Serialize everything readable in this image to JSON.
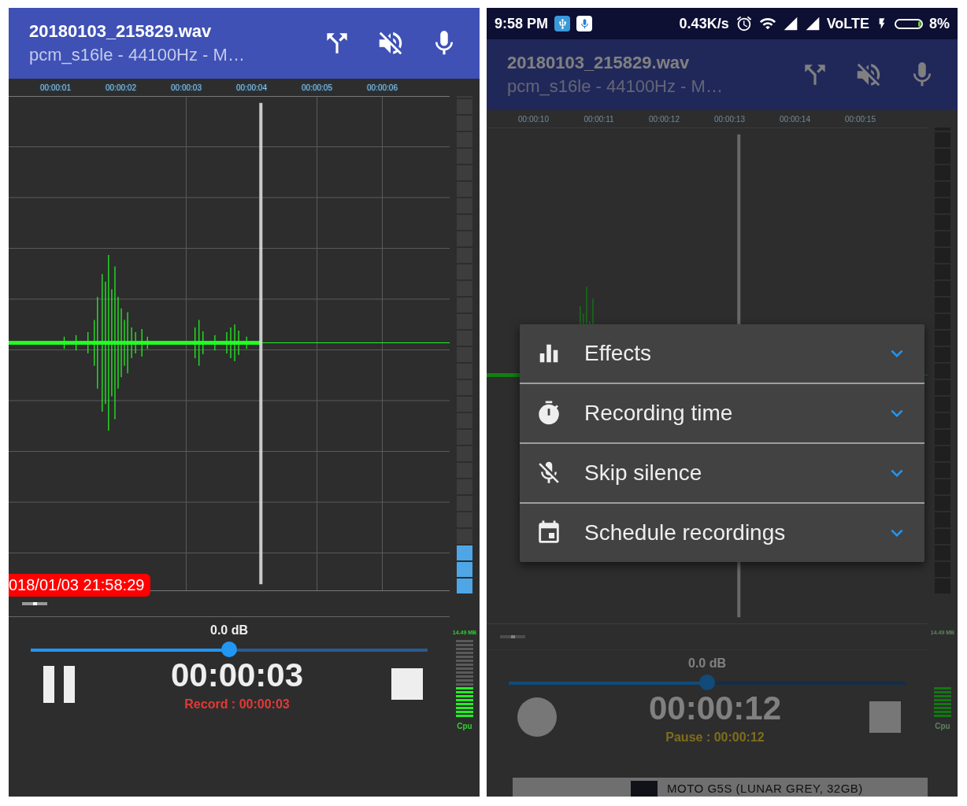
{
  "screens": [
    {
      "dimmed": false,
      "header": {
        "title": "20180103_215829.wav",
        "subtitle": "pcm_s16le - 44100Hz - M…"
      },
      "ruler": [
        "00:00:01",
        "00:00:02",
        "00:00:03",
        "00:00:04",
        "00:00:05",
        "00:00:06"
      ],
      "timestamp": "018/01/03 21:58:29",
      "input_meter": {
        "level": 0.1
      },
      "gain": {
        "reading": "0.0 dB",
        "level": 0.5
      },
      "main_button": {
        "kind": "pause"
      },
      "timer": "00:00:03",
      "state": {
        "kind": "record",
        "text": "Record : 00:00:03"
      },
      "storage": "14.49 MB",
      "cpu": {
        "label": "Cpu",
        "level": 0.4
      }
    },
    {
      "dimmed": true,
      "status_bar": {
        "time": "9:58 PM",
        "speed": "0.43K/s",
        "network": "VoLTE",
        "battery": "8%"
      },
      "header": {
        "title": "20180103_215829.wav",
        "subtitle": "pcm_s16le - 44100Hz - M…"
      },
      "ruler": [
        "00:00:10",
        "00:00:11",
        "00:00:12",
        "00:00:13",
        "00:00:14",
        "00:00:15"
      ],
      "gain": {
        "reading": "0.0 dB",
        "level": 0.5
      },
      "main_button": {
        "kind": "record"
      },
      "timer": "00:00:12",
      "state": {
        "kind": "pause",
        "text": "Pause : 00:00:12"
      },
      "storage": "14.49 MB",
      "cpu": {
        "label": "Cpu",
        "level": 0.4
      },
      "ad": {
        "text": "MOTO G5S (LUNAR GREY, 32GB)"
      },
      "menu": [
        {
          "kind": "effects",
          "label": "Effects",
          "expanded": false
        },
        {
          "kind": "timer",
          "label": "Recording time",
          "expanded": false
        },
        {
          "kind": "skip",
          "label": "Skip silence",
          "expanded": false
        },
        {
          "kind": "schedule",
          "label": "Schedule recordings",
          "expanded": false
        }
      ]
    }
  ]
}
